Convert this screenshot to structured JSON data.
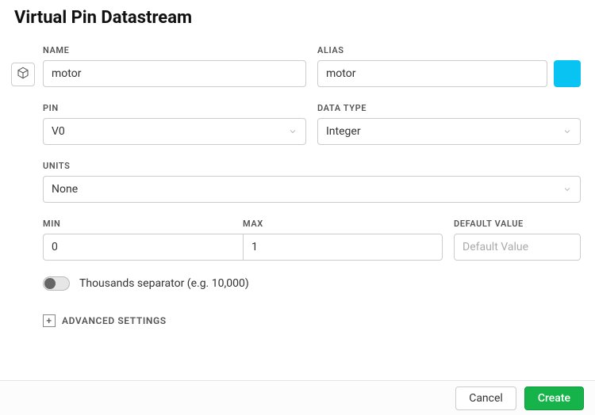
{
  "title": "Virtual Pin Datastream",
  "labels": {
    "name": "NAME",
    "alias": "ALIAS",
    "pin": "PIN",
    "data_type": "DATA TYPE",
    "units": "UNITS",
    "min": "MIN",
    "max": "MAX",
    "default_value": "DEFAULT VALUE"
  },
  "values": {
    "name": "motor",
    "alias": "motor",
    "pin": "V0",
    "data_type": "Integer",
    "units": "None",
    "min": "0",
    "max": "1",
    "default_value": ""
  },
  "placeholders": {
    "default_value": "Default Value"
  },
  "toggle": {
    "thousands_separator_label": "Thousands separator (e.g. 10,000)",
    "thousands_separator_on": false
  },
  "advanced_label": "ADVANCED SETTINGS",
  "buttons": {
    "cancel": "Cancel",
    "create": "Create"
  },
  "color_swatch": "#09c3f2"
}
